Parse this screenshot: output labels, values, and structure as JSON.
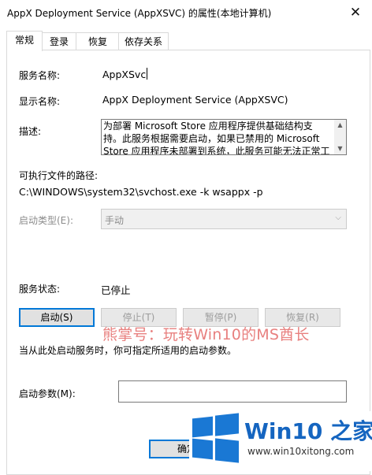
{
  "window": {
    "title": "AppX Deployment Service (AppXSVC) 的属性(本地计算机)"
  },
  "tabs": [
    {
      "label": "常规"
    },
    {
      "label": "登录"
    },
    {
      "label": "恢复"
    },
    {
      "label": "依存关系"
    }
  ],
  "general": {
    "service_name_label": "服务名称:",
    "service_name_value": "AppXSvc",
    "display_name_label": "显示名称:",
    "display_name_value": "AppX Deployment Service (AppXSVC)",
    "description_label": "描述:",
    "description_value": "为部署 Microsoft Store 应用程序提供基础结构支持。此服务根据需要启动，如果已禁用的 Microsoft Store 应用程序未部署到系统，此服务可能无法正常工作。",
    "exe_path_label": "可执行文件的路径:",
    "exe_path_value": "C:\\WINDOWS\\system32\\svchost.exe -k wsappx -p",
    "startup_type_label": "启动类型(E):",
    "startup_type_value": "手动",
    "status_label": "服务状态:",
    "status_value": "已停止",
    "hint_text": "当从此处启动服务时，你可指定所适用的启动参数。",
    "start_params_label": "启动参数(M):",
    "start_params_value": ""
  },
  "buttons": {
    "start": "启动(S)",
    "stop": "停止(T)",
    "pause": "暂停(P)",
    "resume": "恢复(R)",
    "ok": "确定"
  },
  "watermark": {
    "text": "熊掌号：玩转Win10的MS酋长"
  },
  "logo": {
    "name": "Win10 之家",
    "url": "www.win10xitong.com",
    "color": "#1a78d4"
  }
}
